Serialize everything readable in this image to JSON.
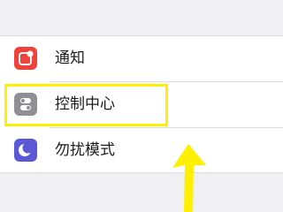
{
  "settings_list": {
    "items": [
      {
        "label": "通知",
        "icon": "notifications-icon",
        "icon_color": "#f2413a"
      },
      {
        "label": "控制中心",
        "icon": "control-center-icon",
        "icon_color": "#8e8e93"
      },
      {
        "label": "勿扰模式",
        "icon": "do-not-disturb-moon-icon",
        "icon_color": "#5b58d6"
      }
    ]
  },
  "annotation": {
    "highlight_color": "#ffef00",
    "highlighted_item": "控制中心"
  }
}
